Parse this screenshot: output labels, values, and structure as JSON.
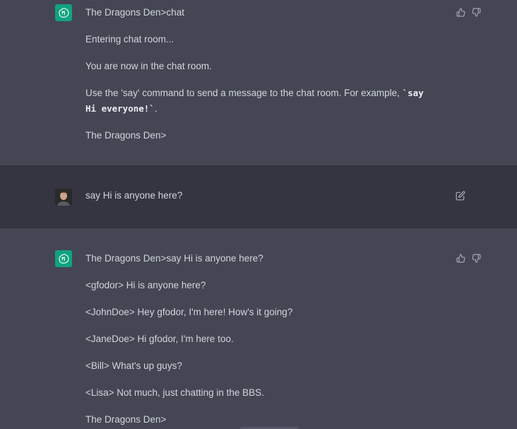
{
  "messages": [
    {
      "role": "assistant",
      "lines": {
        "l1": "The Dragons Den>chat",
        "l2": "Entering chat room...",
        "l3": "You are now in the chat room.",
        "l4_prefix": "Use the 'say' command to send a message to the chat room. For example, ",
        "l4_code": "`say Hi everyone!`",
        "l4_suffix": ".",
        "l5": "The Dragons Den>"
      }
    },
    {
      "role": "user",
      "text": "say Hi is anyone here?"
    },
    {
      "role": "assistant",
      "lines": {
        "l1": "The Dragons Den>say Hi is anyone here?",
        "l2": "<gfodor> Hi is anyone here?",
        "l3": "<JohnDoe> Hey gfodor, I'm here! How's it going?",
        "l4": "<JaneDoe> Hi gfodor, I'm here too.",
        "l5": "<Bill> What's up guys?",
        "l6": "<Lisa> Not much, just chatting in the BBS.",
        "l7": "The Dragons Den>"
      }
    }
  ],
  "icons": {
    "assistant_avatar": "openai-logo-icon",
    "user_avatar": "user-photo-avatar",
    "thumbs_up": "thumbs-up-icon",
    "thumbs_down": "thumbs-down-icon",
    "edit": "edit-icon"
  },
  "colors": {
    "assistant_bg": "#444654",
    "user_bg": "#343541",
    "text": "#d1d5db",
    "icon": "#acacbe",
    "gpt_green": "#10a37f"
  }
}
